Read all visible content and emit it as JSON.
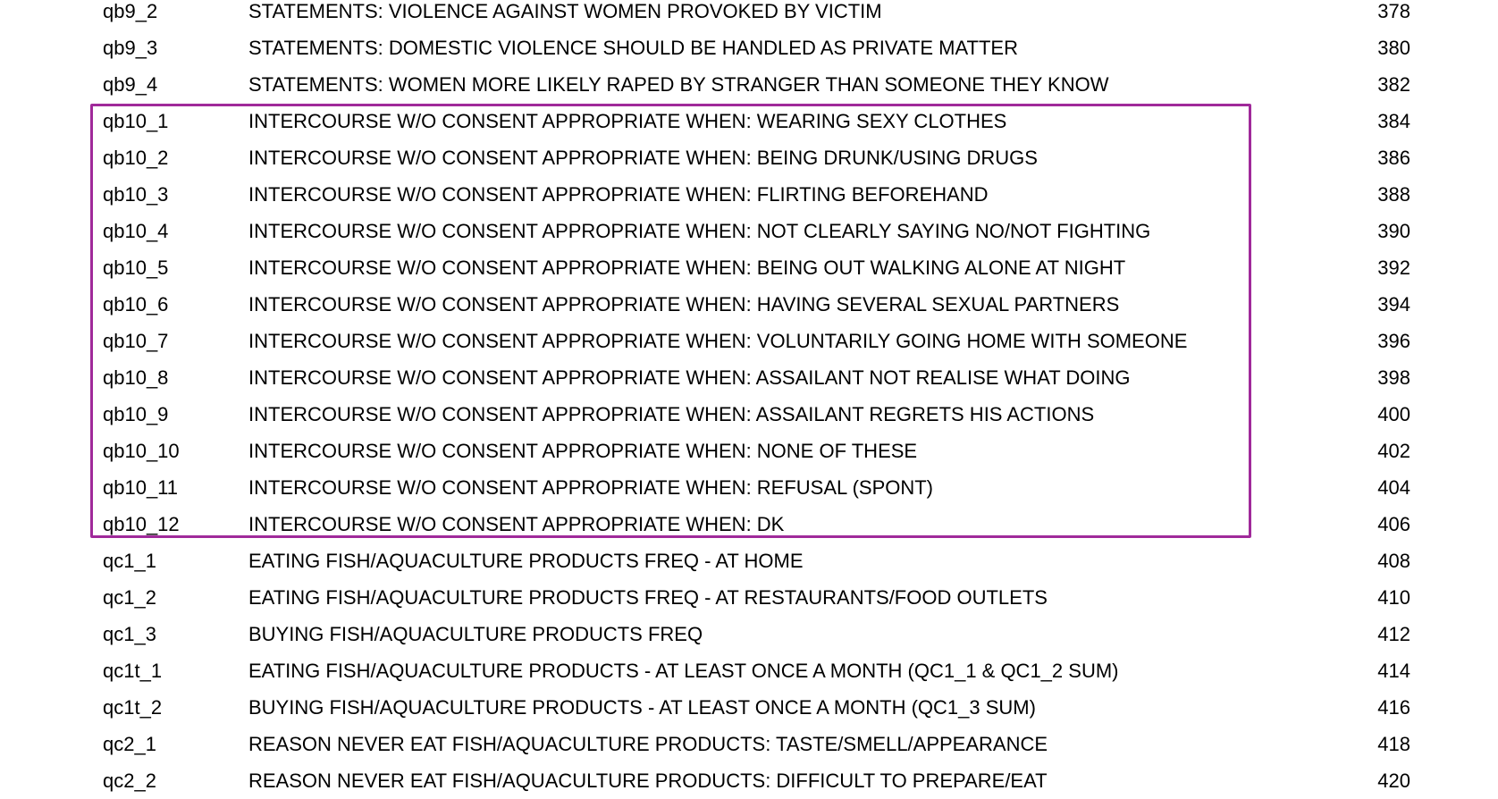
{
  "highlight": {
    "color": "#a02a9a"
  },
  "rows": [
    {
      "var": "qb9_2",
      "label": "STATEMENTS: VIOLENCE AGAINST WOMEN PROVOKED BY VICTIM",
      "page": "378"
    },
    {
      "var": "qb9_3",
      "label": "STATEMENTS: DOMESTIC VIOLENCE SHOULD BE HANDLED AS PRIVATE MATTER",
      "page": "380"
    },
    {
      "var": "qb9_4",
      "label": "STATEMENTS: WOMEN MORE LIKELY RAPED BY STRANGER THAN SOMEONE THEY KNOW",
      "page": "382"
    },
    {
      "var": "qb10_1",
      "label": "INTERCOURSE W/O CONSENT APPROPRIATE WHEN: WEARING SEXY CLOTHES",
      "page": "384"
    },
    {
      "var": "qb10_2",
      "label": "INTERCOURSE W/O CONSENT APPROPRIATE WHEN: BEING DRUNK/USING DRUGS",
      "page": "386"
    },
    {
      "var": "qb10_3",
      "label": "INTERCOURSE W/O CONSENT APPROPRIATE WHEN: FLIRTING BEFOREHAND",
      "page": "388"
    },
    {
      "var": "qb10_4",
      "label": "INTERCOURSE W/O CONSENT APPROPRIATE WHEN: NOT CLEARLY SAYING NO/NOT FIGHTING",
      "page": "390"
    },
    {
      "var": "qb10_5",
      "label": "INTERCOURSE W/O CONSENT APPROPRIATE WHEN: BEING OUT WALKING ALONE AT NIGHT",
      "page": "392"
    },
    {
      "var": "qb10_6",
      "label": "INTERCOURSE W/O CONSENT APPROPRIATE WHEN: HAVING SEVERAL SEXUAL PARTNERS",
      "page": "394"
    },
    {
      "var": "qb10_7",
      "label": "INTERCOURSE W/O CONSENT APPROPRIATE WHEN: VOLUNTARILY GOING HOME WITH SOMEONE",
      "page": "396"
    },
    {
      "var": "qb10_8",
      "label": "INTERCOURSE W/O CONSENT APPROPRIATE WHEN: ASSAILANT  NOT REALISE WHAT DOING",
      "page": "398"
    },
    {
      "var": "qb10_9",
      "label": "INTERCOURSE W/O CONSENT APPROPRIATE WHEN: ASSAILANT REGRETS HIS ACTIONS",
      "page": "400"
    },
    {
      "var": "qb10_10",
      "label": "INTERCOURSE W/O CONSENT APPROPRIATE WHEN: NONE OF THESE",
      "page": "402"
    },
    {
      "var": "qb10_11",
      "label": "INTERCOURSE W/O CONSENT APPROPRIATE WHEN: REFUSAL (SPONT)",
      "page": "404"
    },
    {
      "var": "qb10_12",
      "label": "INTERCOURSE W/O CONSENT APPROPRIATE WHEN: DK",
      "page": "406"
    },
    {
      "var": "qc1_1",
      "label": "EATING FISH/AQUACULTURE PRODUCTS FREQ - AT HOME",
      "page": "408"
    },
    {
      "var": "qc1_2",
      "label": "EATING FISH/AQUACULTURE PRODUCTS FREQ - AT RESTAURANTS/FOOD OUTLETS",
      "page": "410"
    },
    {
      "var": "qc1_3",
      "label": "BUYING FISH/AQUACULTURE PRODUCTS FREQ",
      "page": "412"
    },
    {
      "var": "qc1t_1",
      "label": "EATING FISH/AQUACULTURE PRODUCTS - AT LEAST ONCE A MONTH (QC1_1 & QC1_2 SUM)",
      "page": "414"
    },
    {
      "var": "qc1t_2",
      "label": "BUYING FISH/AQUACULTURE PRODUCTS - AT LEAST ONCE A MONTH (QC1_3 SUM)",
      "page": "416"
    },
    {
      "var": "qc2_1",
      "label": "REASON NEVER EAT FISH/AQUACULTURE PRODUCTS: TASTE/SMELL/APPEARANCE",
      "page": "418"
    },
    {
      "var": "qc2_2",
      "label": "REASON NEVER EAT FISH/AQUACULTURE PRODUCTS: DIFFICULT TO PREPARE/EAT",
      "page": "420"
    }
  ]
}
